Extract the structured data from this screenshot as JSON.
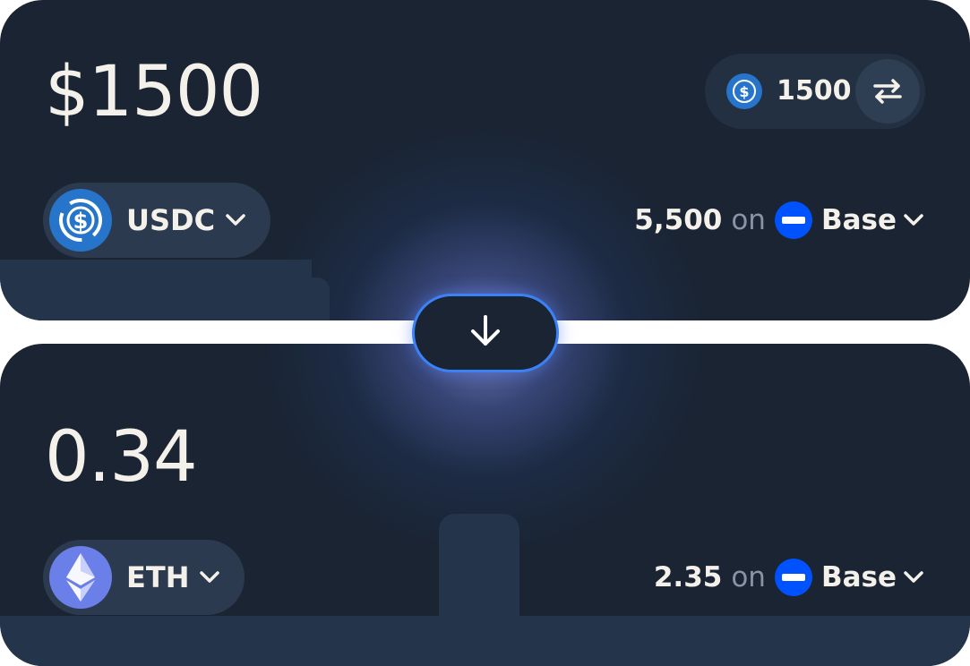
{
  "from": {
    "amount": "$1500",
    "converter": {
      "coin_icon": "usdc-icon",
      "value": "1500",
      "swap_icon": "swap-arrows-icon"
    },
    "token": {
      "symbol": "USDC",
      "icon": "usdc-icon",
      "color": "#2775ca"
    },
    "balance": {
      "value": "5,500",
      "on": "on",
      "network": "Base",
      "network_icon": "base-network-icon"
    }
  },
  "to": {
    "amount": "0.34",
    "token": {
      "symbol": "ETH",
      "icon": "eth-icon",
      "color": "#6b7fe8"
    },
    "balance": {
      "value": "2.35",
      "on": "on",
      "network": "Base",
      "network_icon": "base-network-icon"
    }
  },
  "swap_direction": {
    "icon": "arrow-down-icon",
    "accent": "#3b82f6"
  },
  "colors": {
    "card_bg": "#1a2433",
    "text": "#f4f1ea",
    "muted": "#8a93a3",
    "base_blue": "#0052ff"
  }
}
